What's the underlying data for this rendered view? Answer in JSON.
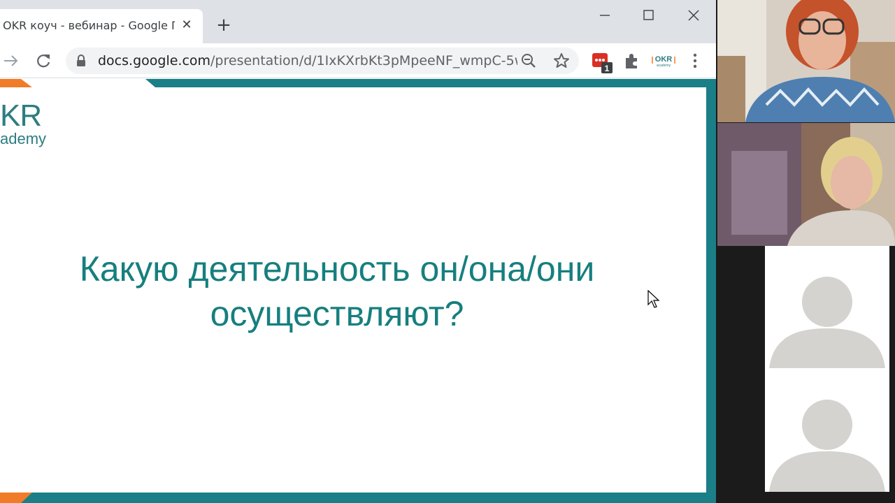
{
  "browser": {
    "tab": {
      "title": "OKR коуч - вебинар - Google П",
      "close_glyph": "✕"
    },
    "new_tab_glyph": "+",
    "url": {
      "host": "docs.google.com",
      "path": "/presentation/d/1IxKXrbKt3pMpeeNF_wmpC-5wj..."
    },
    "extensions": {
      "meet_badge": "1",
      "okr_label": "OKR",
      "okr_sublabel": "academy"
    }
  },
  "slide": {
    "logo": {
      "big": "KR",
      "small": "ademy"
    },
    "question_line1": "Какую деятельность он/она/они",
    "question_line2": "осуществляют?"
  },
  "colors": {
    "teal": "#167f7e",
    "slide_border": "#1a7f86",
    "orange_accent": "#f07c2a",
    "placeholder_avatar": "#d4d3cf"
  },
  "video": {
    "participants": [
      {
        "name": "participant-1",
        "kind": "camera"
      },
      {
        "name": "participant-2",
        "kind": "camera"
      },
      {
        "name": "participant-3",
        "kind": "avatar-placeholder"
      },
      {
        "name": "participant-4",
        "kind": "avatar-placeholder"
      }
    ]
  }
}
